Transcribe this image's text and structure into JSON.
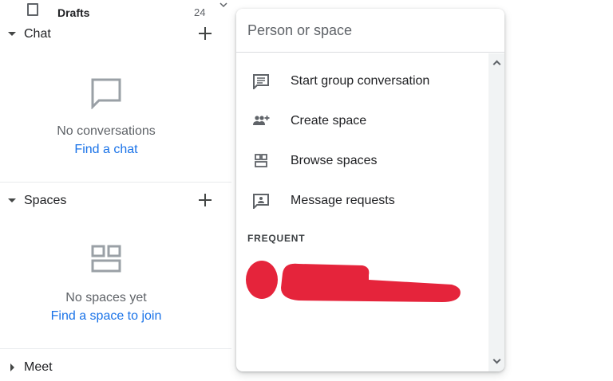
{
  "sidebar": {
    "drafts": {
      "label": "Drafts",
      "count": "24"
    },
    "chat": {
      "title": "Chat",
      "empty_text": "No conversations",
      "link": "Find a chat"
    },
    "spaces": {
      "title": "Spaces",
      "empty_text": "No spaces yet",
      "link": "Find a space to join"
    },
    "meet": {
      "title": "Meet"
    }
  },
  "popup": {
    "search_placeholder": "Person or space",
    "items": [
      {
        "label": "Start group conversation",
        "icon": "chat-lines-icon"
      },
      {
        "label": "Create space",
        "icon": "group-add-icon"
      },
      {
        "label": "Browse spaces",
        "icon": "grid-icon"
      },
      {
        "label": "Message requests",
        "icon": "message-request-icon"
      }
    ],
    "frequent_label": "FREQUENT",
    "frequent_contacts_redacted": true
  },
  "colors": {
    "link": "#1a73e8",
    "icon": "#5f6368",
    "redaction": "#e5243b"
  }
}
